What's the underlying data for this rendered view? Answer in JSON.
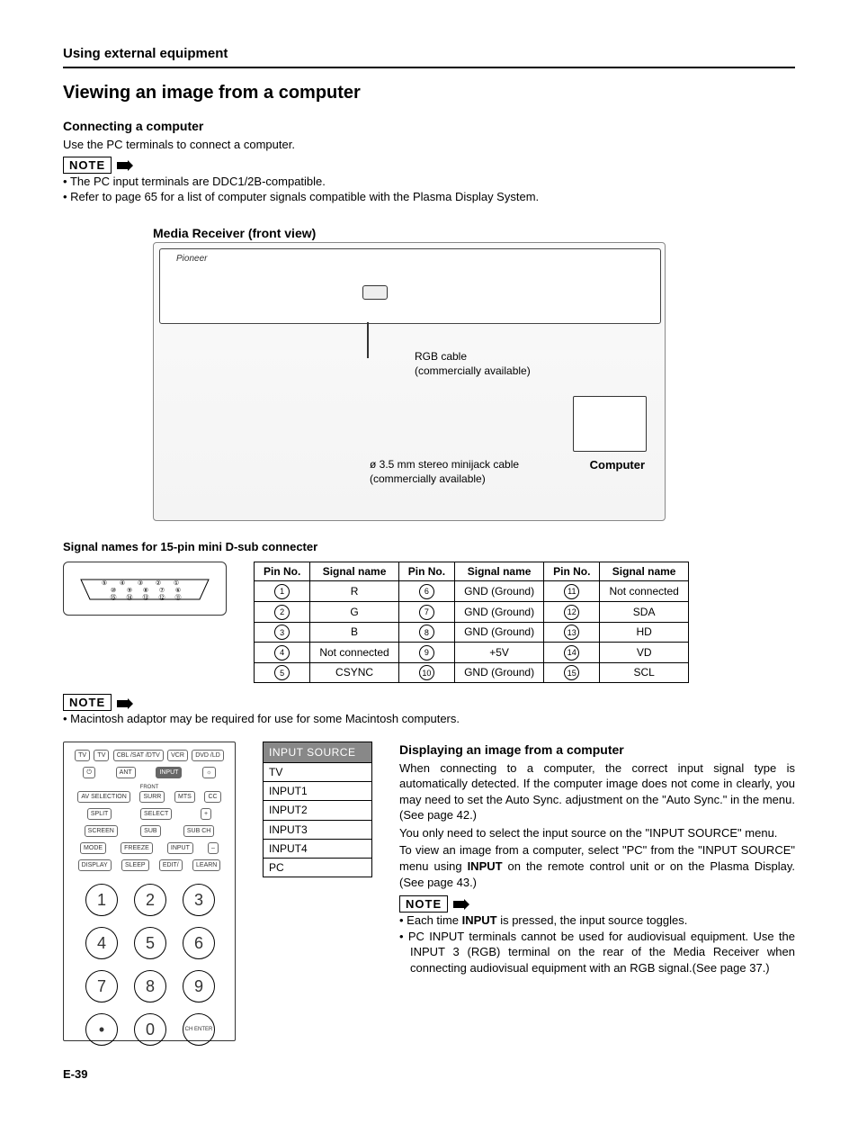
{
  "section": "Using external equipment",
  "title": "Viewing an image from a computer",
  "connecting": {
    "heading": "Connecting a computer",
    "intro": "Use the PC terminals to connect a computer.",
    "note_label": "NOTE",
    "notes": [
      "The PC input terminals are DDC1/2B-compatible.",
      "Refer to page 65 for a list of computer signals compatible with the Plasma Display System."
    ]
  },
  "diagram": {
    "heading": "Media Receiver (front view)",
    "rgb1": "RGB cable",
    "rgb2": "(commercially available)",
    "mini1": "ø 3.5 mm stereo minijack cable",
    "mini2": "(commercially available)",
    "computer": "Computer"
  },
  "pins": {
    "heading": "Signal names for 15-pin mini D-sub connecter",
    "cols": [
      "Pin No.",
      "Signal name",
      "Pin No.",
      "Signal name",
      "Pin No.",
      "Signal name"
    ],
    "rows": [
      [
        "1",
        "R",
        "6",
        "GND (Ground)",
        "11",
        "Not connected"
      ],
      [
        "2",
        "G",
        "7",
        "GND (Ground)",
        "12",
        "SDA"
      ],
      [
        "3",
        "B",
        "8",
        "GND (Ground)",
        "13",
        "HD"
      ],
      [
        "4",
        "Not connected",
        "9",
        "+5V",
        "14",
        "VD"
      ],
      [
        "5",
        "CSYNC",
        "10",
        "GND (Ground)",
        "15",
        "SCL"
      ]
    ]
  },
  "note2_label": "NOTE",
  "note2_items": [
    "Macintosh adaptor may be required for use for some Macintosh computers."
  ],
  "input_source": {
    "header": "INPUT SOURCE",
    "items": [
      "TV",
      "INPUT1",
      "INPUT2",
      "INPUT3",
      "INPUT4",
      "PC"
    ]
  },
  "displaying": {
    "heading": "Displaying an image from a computer",
    "p1": "When connecting to a computer, the correct input signal type is automatically detected. If the computer image does not come in clearly, you may need to set the Auto Sync. adjustment on the \"Auto Sync.\" in the menu. (See page 42.)",
    "p2": "You only need to select the input source on the \"INPUT SOURCE\" menu.",
    "p3a": "To view an image from a computer, select \"PC\" from the \"INPUT SOURCE\" menu using ",
    "p3b": "INPUT",
    "p3c": " on the remote control unit or on the Plasma Display. (See page 43.)",
    "note_label": "NOTE",
    "notes": [
      {
        "pre": "Each time ",
        "bold": "INPUT",
        "post": " is pressed, the input source toggles."
      },
      {
        "pre": "PC INPUT terminals cannot be used for audiovisual equipment. Use the INPUT 3 (RGB) terminal on the rear of the Media Receiver when connecting audiovisual equipment with an RGB signal.(See page 37.)",
        "bold": "",
        "post": ""
      }
    ]
  },
  "remote": {
    "row1": [
      "TV",
      "TV",
      "CBL /SAT /DTV",
      "VCR",
      "DVD /LD"
    ],
    "row2": [
      "⏻",
      "ANT",
      "INPUT",
      "☼"
    ],
    "front": "FRONT",
    "row3": [
      "AV SELECTION",
      "SURR",
      "MTS",
      "CC"
    ],
    "row4": [
      "SPLIT",
      "SELECT",
      "+"
    ],
    "row5": [
      "SCREEN",
      "SUB",
      "SUB CH"
    ],
    "row6": [
      "MODE",
      "FREEZE",
      "INPUT",
      "–"
    ],
    "row7": [
      "DISPLAY",
      "SLEEP",
      "EDIT/",
      "LEARN"
    ],
    "numpad": [
      "1",
      "2",
      "3",
      "4",
      "5",
      "6",
      "7",
      "8",
      "9",
      "•",
      "0",
      "CH ENTER"
    ]
  },
  "page": "E-39"
}
